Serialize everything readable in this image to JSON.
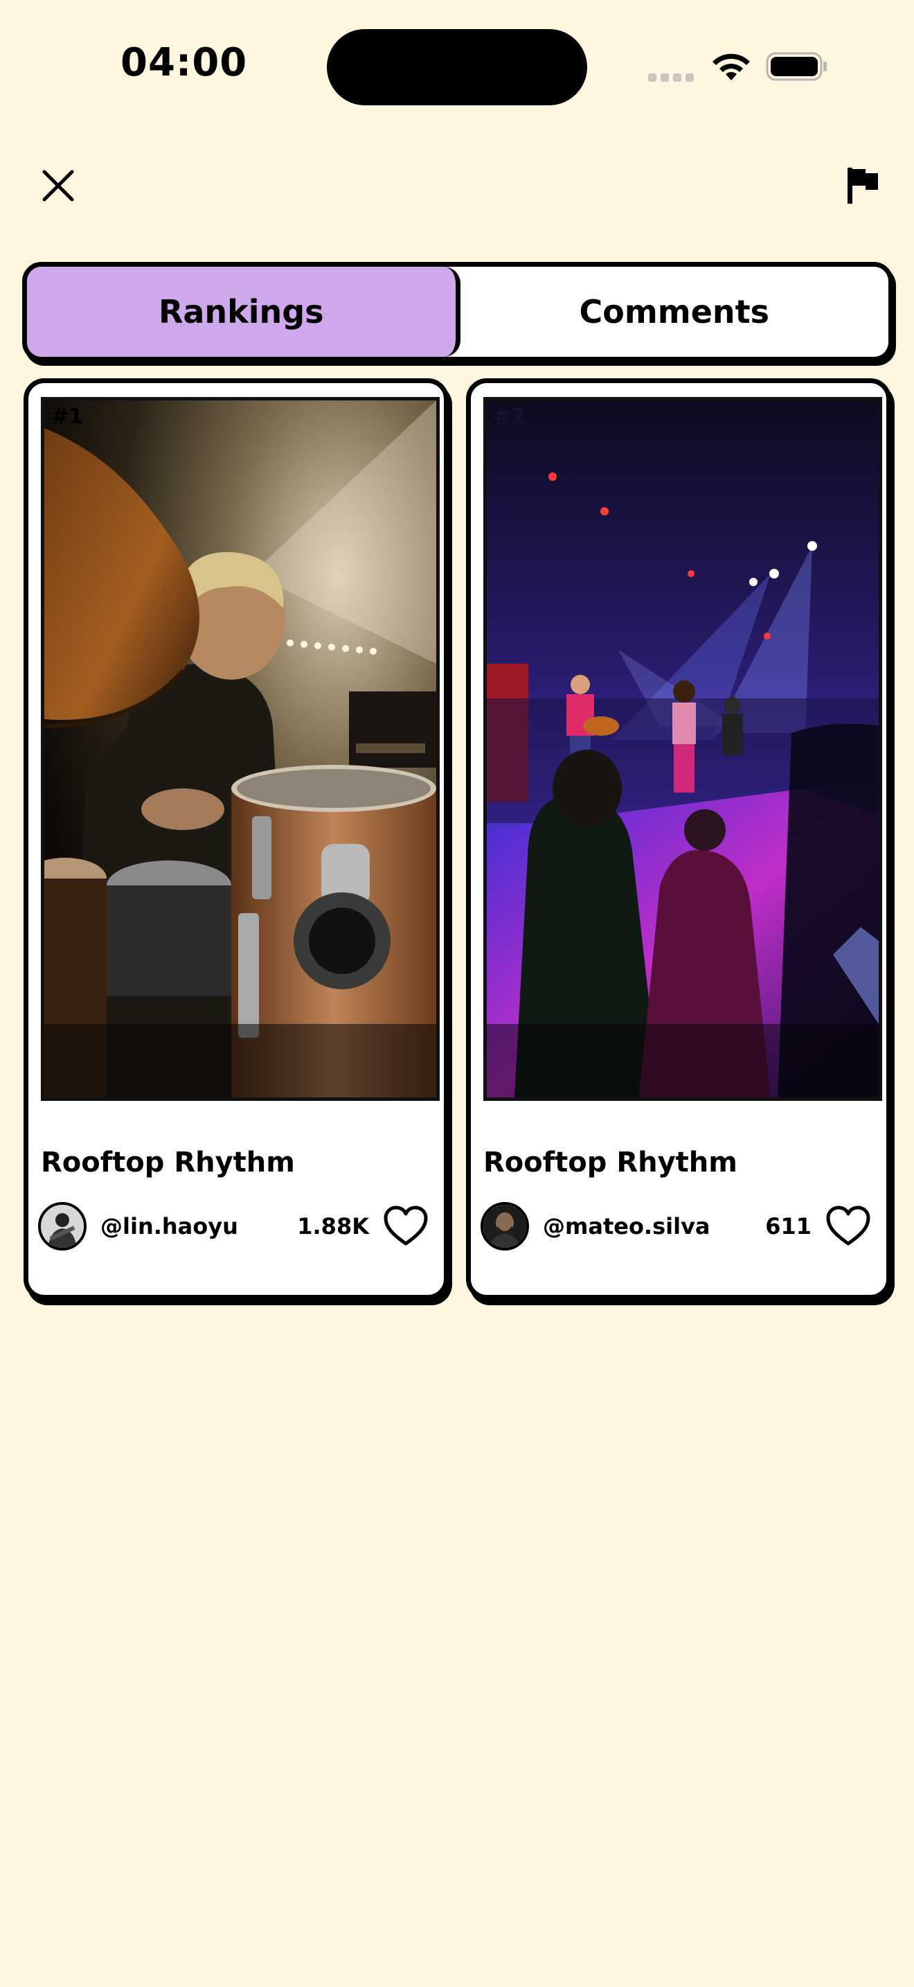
{
  "status_bar": {
    "time": "04:00",
    "icons": [
      "cellular-signal-icon",
      "wifi-icon",
      "battery-icon"
    ]
  },
  "nav": {
    "close_icon": "close-icon",
    "report_icon": "flag-icon"
  },
  "tabs": [
    {
      "label": "Rankings",
      "active": true
    },
    {
      "label": "Comments",
      "active": false
    }
  ],
  "entries": [
    {
      "rank": "#1",
      "title": "Rooftop Rhythm",
      "handle": "@lin.haoyu",
      "likes": "1.88K",
      "photo": "drummer-photo"
    },
    {
      "rank": "#2",
      "title": "Rooftop Rhythm",
      "handle": "@mateo.silva",
      "likes": "611",
      "photo": "concert-stage-photo"
    }
  ],
  "colors": {
    "background": "#FEF6DF",
    "active_tab": "#CFA8EB",
    "border": "#000000"
  }
}
